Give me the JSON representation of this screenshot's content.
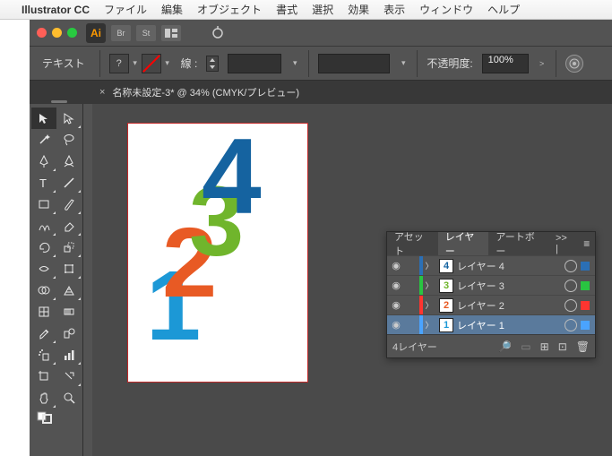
{
  "menubar": {
    "apple": "",
    "app": "Illustrator CC",
    "items": [
      "ファイル",
      "編集",
      "オブジェクト",
      "書式",
      "選択",
      "効果",
      "表示",
      "ウィンドウ",
      "ヘルプ"
    ]
  },
  "top": {
    "ai": "Ai",
    "br": "Br",
    "st": "St"
  },
  "control": {
    "label": "テキスト",
    "fill_char": "?",
    "stroke_label": "線 :",
    "opacity_label": "不透明度:",
    "opacity_value": "100%"
  },
  "tab": {
    "close": "×",
    "title": "名称未設定-3* @ 34% (CMYK/プレビュー)"
  },
  "canvas": {
    "n1": "1",
    "n2": "2",
    "n3": "3",
    "n4": "4"
  },
  "layersPanel": {
    "tabs": {
      "assets": "アセット",
      "layers": "レイヤー",
      "artboards": "アートボー",
      "more": ">> |"
    },
    "menu_icon": "≡",
    "rows": [
      {
        "vis": "◉",
        "color": "#2b6fb5",
        "thumb": "4",
        "thumb_color": "#1563a0",
        "name": "レイヤー 4",
        "sel": "#2b6fb5",
        "selected": false
      },
      {
        "vis": "◉",
        "color": "#29c441",
        "thumb": "3",
        "thumb_color": "#70b52c",
        "name": "レイヤー 3",
        "sel": "#29c441",
        "selected": false
      },
      {
        "vis": "◉",
        "color": "#ff3530",
        "thumb": "2",
        "thumb_color": "#e85a24",
        "name": "レイヤー 2",
        "sel": "#ff3530",
        "selected": false
      },
      {
        "vis": "◉",
        "color": "#4aa3ff",
        "thumb": "1",
        "thumb_color": "#1c98d6",
        "name": "レイヤー 1",
        "sel": "#4aa3ff",
        "selected": true
      }
    ],
    "footer": {
      "count": "4レイヤー",
      "find": "🔎",
      "clip": "▭",
      "new_sub": "⊞",
      "new": "⊡",
      "trash": "🗑"
    }
  }
}
